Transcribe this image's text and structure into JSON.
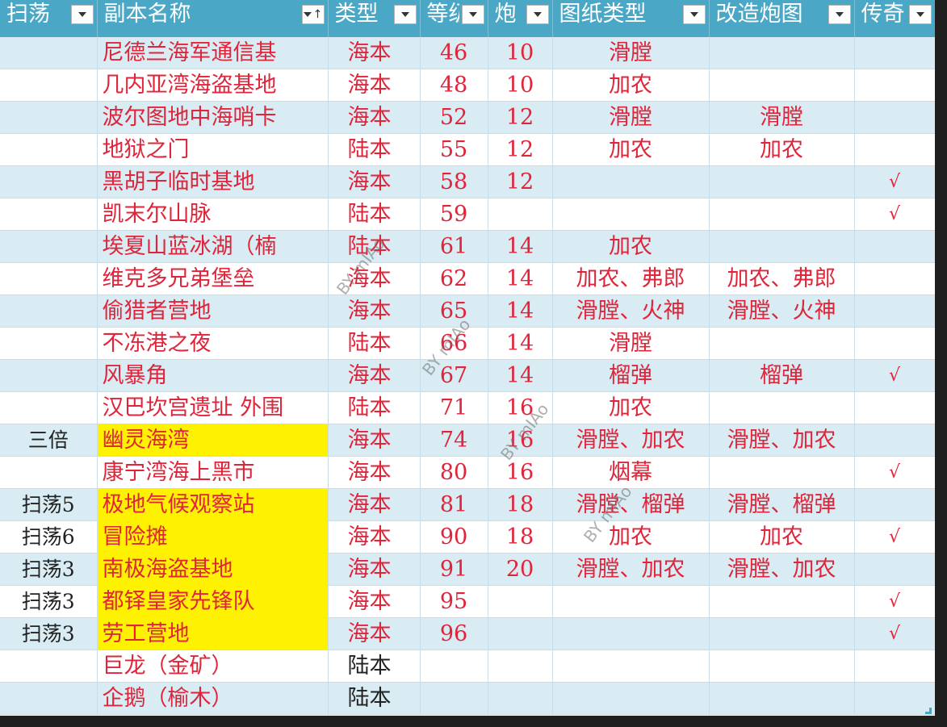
{
  "columns": [
    {
      "label": "扫荡",
      "width": 120,
      "sorted": false
    },
    {
      "label": "副本名称",
      "width": 286,
      "sorted": true
    },
    {
      "label": "类型",
      "width": 114,
      "sorted": false
    },
    {
      "label": "等级",
      "width": 84,
      "sorted": false
    },
    {
      "label": "炮",
      "width": 80,
      "sorted": false
    },
    {
      "label": "图纸类型",
      "width": 194,
      "sorted": false
    },
    {
      "label": "改造炮图",
      "width": 180,
      "sorted": false
    },
    {
      "label": "传奇",
      "width": 100,
      "sorted": false
    }
  ],
  "rows": [
    {
      "sweep": "",
      "name": "尼德兰海军通信基",
      "type": "海本",
      "level": "46",
      "gun": "10",
      "blueprint": "滑膛",
      "mod": "",
      "legend": "",
      "hl": false,
      "dark": false
    },
    {
      "sweep": "",
      "name": "几内亚湾海盗基地",
      "type": "海本",
      "level": "48",
      "gun": "10",
      "blueprint": "加农",
      "mod": "",
      "legend": "",
      "hl": false,
      "dark": false
    },
    {
      "sweep": "",
      "name": "波尔图地中海哨卡",
      "type": "海本",
      "level": "52",
      "gun": "12",
      "blueprint": "滑膛",
      "mod": "滑膛",
      "legend": "",
      "hl": false,
      "dark": false
    },
    {
      "sweep": "",
      "name": "地狱之门",
      "type": "陆本",
      "level": "55",
      "gun": "12",
      "blueprint": "加农",
      "mod": "加农",
      "legend": "",
      "hl": false,
      "dark": false
    },
    {
      "sweep": "",
      "name": "黑胡子临时基地",
      "type": "海本",
      "level": "58",
      "gun": "12",
      "blueprint": "",
      "mod": "",
      "legend": "√",
      "hl": false,
      "dark": false
    },
    {
      "sweep": "",
      "name": "凯末尔山脉",
      "type": "陆本",
      "level": "59",
      "gun": "",
      "blueprint": "",
      "mod": "",
      "legend": "√",
      "hl": false,
      "dark": false
    },
    {
      "sweep": "",
      "name": "埃夏山蓝冰湖（楠",
      "type": "陆本",
      "level": "61",
      "gun": "14",
      "blueprint": "加农",
      "mod": "",
      "legend": "",
      "hl": false,
      "dark": false
    },
    {
      "sweep": "",
      "name": "维克多兄弟堡垒",
      "type": "海本",
      "level": "62",
      "gun": "14",
      "blueprint": "加农、弗郎",
      "mod": "加农、弗郎",
      "legend": "",
      "hl": false,
      "dark": false
    },
    {
      "sweep": "",
      "name": "偷猎者营地",
      "type": "海本",
      "level": "65",
      "gun": "14",
      "blueprint": "滑膛、火神",
      "mod": "滑膛、火神",
      "legend": "",
      "hl": false,
      "dark": false
    },
    {
      "sweep": "",
      "name": "不冻港之夜",
      "type": "陆本",
      "level": "66",
      "gun": "14",
      "blueprint": "滑膛",
      "mod": "",
      "legend": "",
      "hl": false,
      "dark": false
    },
    {
      "sweep": "",
      "name": "风暴角",
      "type": "海本",
      "level": "67",
      "gun": "14",
      "blueprint": "榴弹",
      "mod": "榴弹",
      "legend": "√",
      "hl": false,
      "dark": false
    },
    {
      "sweep": "",
      "name": "汉巴坎宫遗址 外围",
      "type": "陆本",
      "level": "71",
      "gun": "16",
      "blueprint": "加农",
      "mod": "",
      "legend": "",
      "hl": false,
      "dark": false
    },
    {
      "sweep": "三倍",
      "name": "幽灵海湾",
      "type": "海本",
      "level": "74",
      "gun": "16",
      "blueprint": "滑膛、加农",
      "mod": "滑膛、加农",
      "legend": "",
      "hl": true,
      "dark": false
    },
    {
      "sweep": "",
      "name": "康宁湾海上黑市",
      "type": "海本",
      "level": "80",
      "gun": "16",
      "blueprint": "烟幕",
      "mod": "",
      "legend": "√",
      "hl": false,
      "dark": false
    },
    {
      "sweep": "扫荡5",
      "name": "极地气候观察站",
      "type": "海本",
      "level": "81",
      "gun": "18",
      "blueprint": "滑膛、榴弹",
      "mod": "滑膛、榴弹",
      "legend": "",
      "hl": true,
      "dark": false
    },
    {
      "sweep": "扫荡6",
      "name": "冒险摊",
      "type": "海本",
      "level": "90",
      "gun": "18",
      "blueprint": "加农",
      "mod": "加农",
      "legend": "√",
      "hl": true,
      "dark": false
    },
    {
      "sweep": "扫荡3",
      "name": "南极海盗基地",
      "type": "海本",
      "level": "91",
      "gun": "20",
      "blueprint": "滑膛、加农",
      "mod": "滑膛、加农",
      "legend": "",
      "hl": true,
      "dark": false
    },
    {
      "sweep": "扫荡3",
      "name": "都铎皇家先锋队",
      "type": "海本",
      "level": "95",
      "gun": "",
      "blueprint": "",
      "mod": "",
      "legend": "√",
      "hl": true,
      "dark": false
    },
    {
      "sweep": "扫荡3",
      "name": "劳工营地",
      "type": "海本",
      "level": "96",
      "gun": "",
      "blueprint": "",
      "mod": "",
      "legend": "√",
      "hl": true,
      "dark": false
    },
    {
      "sweep": "",
      "name": "巨龙（金矿）",
      "type": "陆本",
      "level": "",
      "gun": "",
      "blueprint": "",
      "mod": "",
      "legend": "",
      "hl": false,
      "dark": true
    },
    {
      "sweep": "",
      "name": "企鹅（榆木）",
      "type": "陆本",
      "level": "",
      "gun": "",
      "blueprint": "",
      "mod": "",
      "legend": "",
      "hl": false,
      "dark": true
    }
  ],
  "watermark_text": "BY mIAo",
  "colors": {
    "header_bg": "#4ba7c6",
    "band_bg": "#d9ecf3",
    "highlight": "#fff200",
    "text_red": "#e0243a"
  },
  "icons": {
    "filter": "dropdown-triangle-icon",
    "sort": "sort-arrow-icon"
  }
}
